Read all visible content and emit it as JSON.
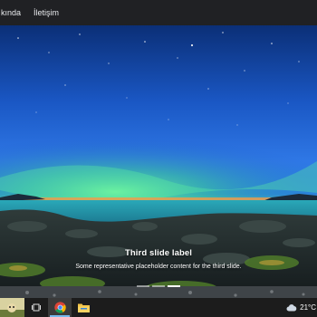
{
  "navbar": {
    "links": [
      {
        "label": "kında"
      },
      {
        "label": "İletişim"
      }
    ]
  },
  "carousel": {
    "slide_title": "Third slide label",
    "slide_text": "Some representative placeholder content for the third slide.",
    "indicator_count": 3,
    "active_indicator": 2
  },
  "taskbar": {
    "weather_icon": "cloud-icon",
    "temperature": "21°C",
    "apps": [
      "chrome-icon",
      "file-explorer-icon"
    ]
  },
  "colors": {
    "nav_bg": "#202124",
    "taskbar_bg": "#1c1c1c",
    "accent": "#76b9ed"
  }
}
